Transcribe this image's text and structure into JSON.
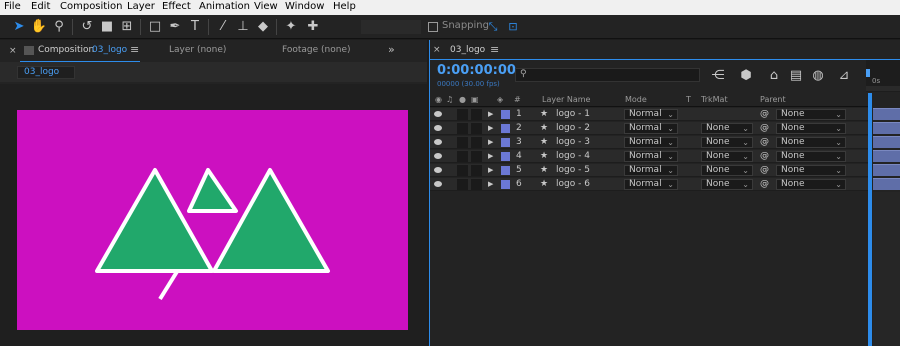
{
  "menu": [
    "File",
    "Edit",
    "Composition",
    "Layer",
    "Effect",
    "Animation",
    "View",
    "Window",
    "Help"
  ],
  "toolbar": {
    "snapping_label": "Snapping"
  },
  "comp_panel": {
    "tab_prefix": "Composition",
    "tab_name": "03_logo",
    "layer_tab": "Layer (none)",
    "footage_tab": "Footage (none)",
    "breadcrumb": "03_logo",
    "canvas_color": "#cc10c0",
    "logo_color": "#21a86b"
  },
  "timeline": {
    "tab": "03_logo",
    "timecode": "0:00:00:00",
    "fps": "00000 (30.00 fps)",
    "ruler_label": "0s",
    "headers": {
      "num": "#",
      "layer_name": "Layer Name",
      "mode": "Mode",
      "t": "T",
      "trkmat": "TrkMat",
      "parent": "Parent"
    },
    "layers": [
      {
        "num": "1",
        "name": "logo - 1",
        "mode": "Normal",
        "trkmat": "",
        "parent": "None"
      },
      {
        "num": "2",
        "name": "logo - 2",
        "mode": "Normal",
        "trkmat": "None",
        "parent": "None"
      },
      {
        "num": "3",
        "name": "logo - 3",
        "mode": "Normal",
        "trkmat": "None",
        "parent": "None"
      },
      {
        "num": "4",
        "name": "logo - 4",
        "mode": "Normal",
        "trkmat": "None",
        "parent": "None"
      },
      {
        "num": "5",
        "name": "logo - 5",
        "mode": "Normal",
        "trkmat": "None",
        "parent": "None"
      },
      {
        "num": "6",
        "name": "logo - 6",
        "mode": "Normal",
        "trkmat": "None",
        "parent": "None"
      }
    ]
  }
}
